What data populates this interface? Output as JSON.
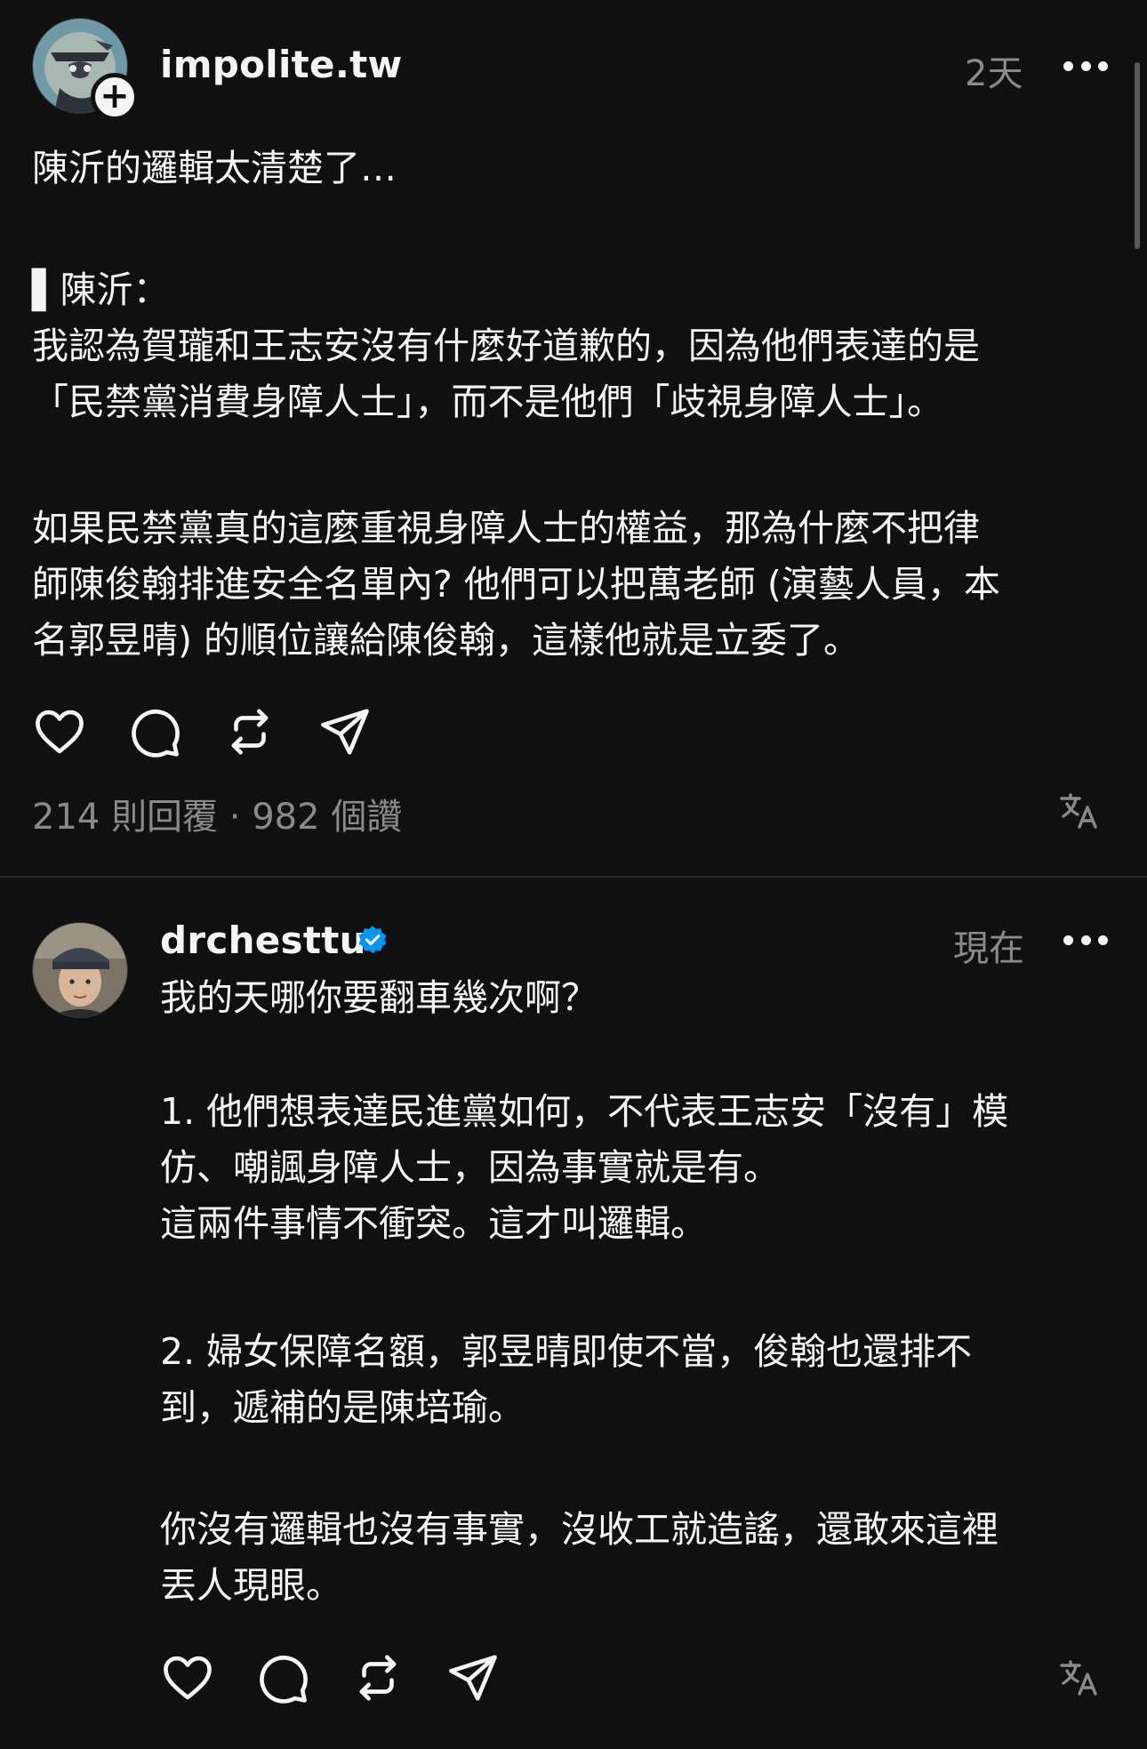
{
  "post_main": {
    "username": "impolite.tw",
    "timestamp": "2天",
    "paragraphs": [
      "陳沂的邏輯太清楚了…",
      "▌陳沂：\n我認為賀瓏和王志安沒有什麼好道歉的，因為他們表達的是\n「民禁黨消費身障人士」，而不是他們「歧視身障人士」。",
      "如果民禁黨真的這麼重視身障人士的權益，那為什麼不把律\n師陳俊翰排進安全名單內? 他們可以把萬老師 (演藝人員，本\n名郭昱晴) 的順位讓給陳俊翰，這樣他就是立委了。"
    ],
    "stats": "214 則回覆 · 982 個讚",
    "avatar_icon": "profile-avatar",
    "follow_icon": "plus-icon"
  },
  "post_reply": {
    "username": "drchesttu",
    "timestamp": "現在",
    "verified_icon": "verified-badge-icon",
    "paragraphs": [
      "我的天哪你要翻車幾次啊？",
      "1. 他們想表達民進黨如何，不代表王志安「沒有」模\n仿、嘲諷身障人士，因為事實就是有。\n這兩件事情不衝突。這才叫邏輯。",
      "2. 婦女保障名額，郭昱晴即使不當，俊翰也還排不\n到，遞補的是陳培瑜。",
      "你沒有邏輯也沒有事實，沒收工就造謠，還敢來這裡\n丟人現眼。"
    ]
  },
  "icons": {
    "like": "heart-icon",
    "reply": "comment-icon",
    "repost": "repost-icon",
    "share": "send-icon",
    "translate": "translate-icon",
    "more": "more-icon"
  },
  "colors": {
    "background": "#101010",
    "text": "#f3f5f7",
    "secondary": "#8a8a8a",
    "verified": "#0095f6"
  }
}
